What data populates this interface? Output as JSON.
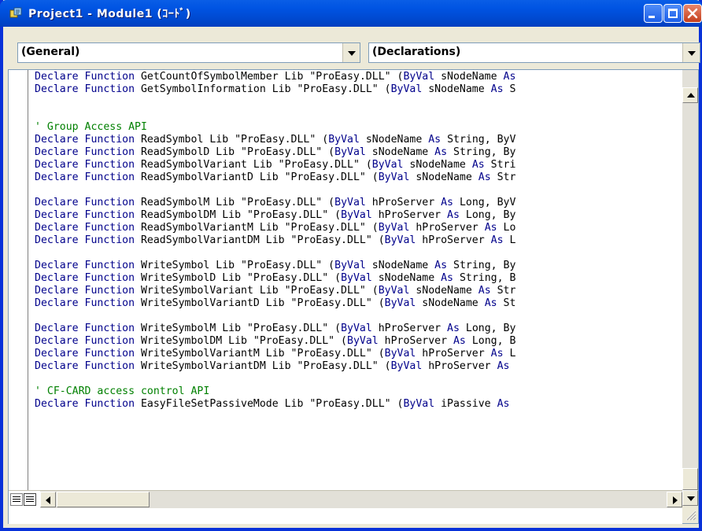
{
  "window": {
    "title": "Project1 - Module1 (ｺｰﾄﾞ)",
    "icon": "vba-module-icon",
    "caption_buttons": [
      "minimize",
      "maximize",
      "close"
    ]
  },
  "procedure_bar": {
    "object_combo": "(General)",
    "procedure_combo": "(Declarations)"
  },
  "editor": {
    "lines": [
      {
        "type": "decl",
        "kw": "Declare Function ",
        "name": "GetCountOfSymbolMember",
        "lib": " Lib \"ProEasy.DLL\" (",
        "byval": "ByVal",
        "param": " sNodeName ",
        "as": "As",
        "tail": ""
      },
      {
        "type": "decl",
        "kw": "Declare Function ",
        "name": "GetSymbolInformation",
        "lib": " Lib \"ProEasy.DLL\" (",
        "byval": "ByVal",
        "param": " sNodeName ",
        "as": "As",
        "tail": " S"
      },
      {
        "type": "blank"
      },
      {
        "type": "blank"
      },
      {
        "type": "comment",
        "text": "' Group Access API"
      },
      {
        "type": "decl",
        "kw": "Declare Function ",
        "name": "ReadSymbol",
        "lib": " Lib \"ProEasy.DLL\" (",
        "byval": "ByVal",
        "param": " sNodeName ",
        "as": "As",
        "tail": " String, ByV"
      },
      {
        "type": "decl",
        "kw": "Declare Function ",
        "name": "ReadSymbolD",
        "lib": " Lib \"ProEasy.DLL\" (",
        "byval": "ByVal",
        "param": " sNodeName ",
        "as": "As",
        "tail": " String, By"
      },
      {
        "type": "decl",
        "kw": "Declare Function ",
        "name": "ReadSymbolVariant",
        "lib": " Lib \"ProEasy.DLL\" (",
        "byval": "ByVal",
        "param": " sNodeName ",
        "as": "As",
        "tail": " Stri"
      },
      {
        "type": "decl",
        "kw": "Declare Function ",
        "name": "ReadSymbolVariantD",
        "lib": " Lib \"ProEasy.DLL\" (",
        "byval": "ByVal",
        "param": " sNodeName ",
        "as": "As",
        "tail": " Str"
      },
      {
        "type": "blank"
      },
      {
        "type": "decl",
        "kw": "Declare Function ",
        "name": "ReadSymbolM",
        "lib": " Lib \"ProEasy.DLL\" (",
        "byval": "ByVal",
        "param": " hProServer ",
        "as": "As",
        "tail": " Long, ByV"
      },
      {
        "type": "decl",
        "kw": "Declare Function ",
        "name": "ReadSymbolDM",
        "lib": " Lib \"ProEasy.DLL\" (",
        "byval": "ByVal",
        "param": " hProServer ",
        "as": "As",
        "tail": " Long, By"
      },
      {
        "type": "decl",
        "kw": "Declare Function ",
        "name": "ReadSymbolVariantM",
        "lib": " Lib \"ProEasy.DLL\" (",
        "byval": "ByVal",
        "param": " hProServer ",
        "as": "As",
        "tail": " Lo"
      },
      {
        "type": "decl",
        "kw": "Declare Function ",
        "name": "ReadSymbolVariantDM",
        "lib": " Lib \"ProEasy.DLL\" (",
        "byval": "ByVal",
        "param": " hProServer ",
        "as": "As",
        "tail": " L"
      },
      {
        "type": "blank"
      },
      {
        "type": "decl",
        "kw": "Declare Function ",
        "name": "WriteSymbol",
        "lib": " Lib \"ProEasy.DLL\" (",
        "byval": "ByVal",
        "param": " sNodeName ",
        "as": "As",
        "tail": " String, By"
      },
      {
        "type": "decl",
        "kw": "Declare Function ",
        "name": "WriteSymbolD",
        "lib": " Lib \"ProEasy.DLL\" (",
        "byval": "ByVal",
        "param": " sNodeName ",
        "as": "As",
        "tail": " String, B"
      },
      {
        "type": "decl",
        "kw": "Declare Function ",
        "name": "WriteSymbolVariant",
        "lib": " Lib \"ProEasy.DLL\" (",
        "byval": "ByVal",
        "param": " sNodeName ",
        "as": "As",
        "tail": " Str"
      },
      {
        "type": "decl",
        "kw": "Declare Function ",
        "name": "WriteSymbolVariantD",
        "lib": " Lib \"ProEasy.DLL\" (",
        "byval": "ByVal",
        "param": " sNodeName ",
        "as": "As",
        "tail": " St"
      },
      {
        "type": "blank"
      },
      {
        "type": "decl",
        "kw": "Declare Function ",
        "name": "WriteSymbolM",
        "lib": " Lib \"ProEasy.DLL\" (",
        "byval": "ByVal",
        "param": " hProServer ",
        "as": "As",
        "tail": " Long, By"
      },
      {
        "type": "decl",
        "kw": "Declare Function ",
        "name": "WriteSymbolDM",
        "lib": " Lib \"ProEasy.DLL\" (",
        "byval": "ByVal",
        "param": " hProServer ",
        "as": "As",
        "tail": " Long, B"
      },
      {
        "type": "decl",
        "kw": "Declare Function ",
        "name": "WriteSymbolVariantM",
        "lib": " Lib \"ProEasy.DLL\" (",
        "byval": "ByVal",
        "param": " hProServer ",
        "as": "As",
        "tail": " L"
      },
      {
        "type": "decl",
        "kw": "Declare Function ",
        "name": "WriteSymbolVariantDM",
        "lib": " Lib \"ProEasy.DLL\" (",
        "byval": "ByVal",
        "param": " hProServer ",
        "as": "As",
        "tail": ""
      },
      {
        "type": "blank"
      },
      {
        "type": "comment",
        "text": "' CF-CARD access control API"
      },
      {
        "type": "decl",
        "kw": "Declare Function ",
        "name": "EasyFileSetPassiveMode",
        "lib": " Lib \"ProEasy.DLL\" (",
        "byval": "ByVal",
        "param": " iPassive ",
        "as": "As",
        "tail": ""
      }
    ]
  },
  "view_buttons": [
    "procedure-view",
    "full-module-view"
  ],
  "colors": {
    "keyword": "#00008b",
    "comment": "#008000",
    "title_bar": "#0054e3",
    "frame": "#ece9d8"
  }
}
